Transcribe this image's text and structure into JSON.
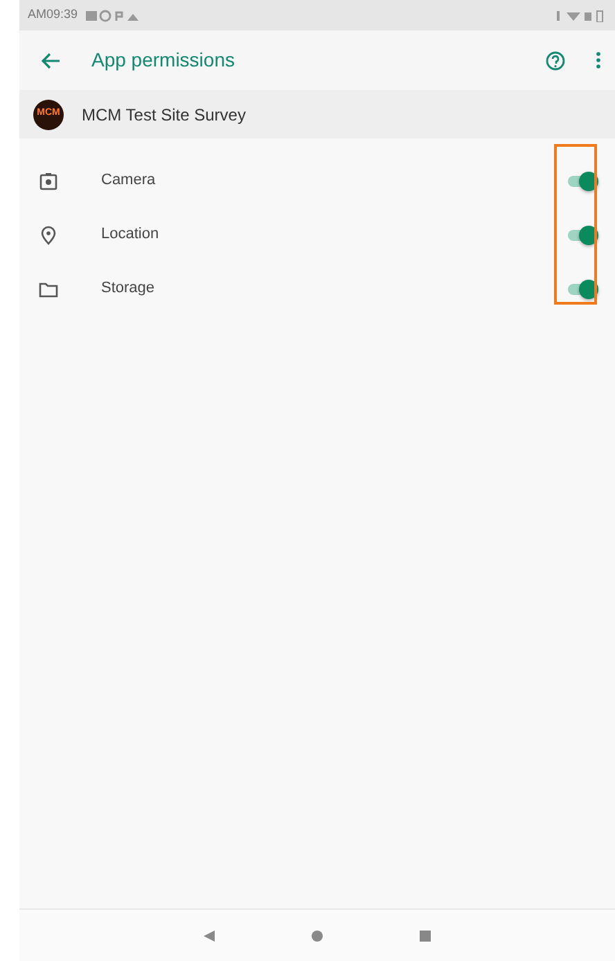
{
  "status_bar": {
    "time": "AM09:39"
  },
  "app_bar": {
    "title": "App permissions"
  },
  "app": {
    "logo_text": "MCM",
    "name": "MCM Test Site Survey"
  },
  "permissions": [
    {
      "kind": "camera",
      "label": "Camera",
      "on": true
    },
    {
      "kind": "location",
      "label": "Location",
      "on": true
    },
    {
      "kind": "storage",
      "label": "Storage",
      "on": true
    }
  ],
  "highlight": {
    "shown": true
  }
}
